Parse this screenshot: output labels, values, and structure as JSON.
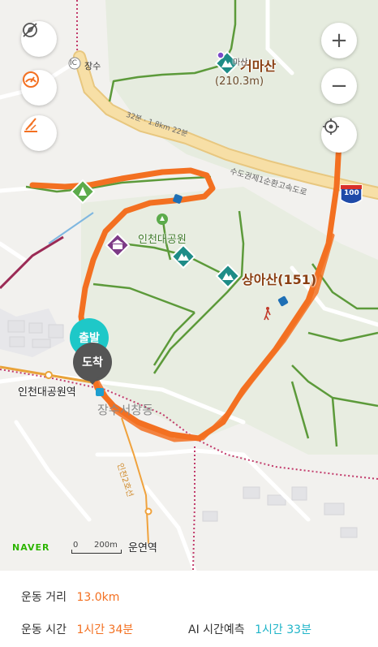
{
  "map": {
    "peaks": {
      "geoma": {
        "name": "거마산",
        "height": "(210.3m)",
        "sub": "마산"
      },
      "sanga": {
        "name": "상아산(151)"
      }
    },
    "park": {
      "name": "인천대공원"
    },
    "stations": {
      "incheon_park": "인천대공원역",
      "unyeon": "운연역",
      "ic": "IC",
      "jangsu": "장수"
    },
    "area": {
      "name": "장수서창동"
    },
    "roads": {
      "expressway": "수도권제1순환고속도로",
      "route_shield": "100",
      "trail_time": "32분 · 1.8km 22분",
      "rail_line": "인천2호선"
    },
    "markers": {
      "start": "출발",
      "end": "도착"
    },
    "logo": "NAVER",
    "scale": {
      "zero": "0",
      "distance": "200m"
    }
  },
  "controls": {
    "left": [
      "compass-off-icon",
      "speed-gauge-icon",
      "route-edit-icon"
    ],
    "zoom_in": "+",
    "zoom_out": "−",
    "locate": "locate-icon"
  },
  "stats": {
    "distance_label": "운동 거리",
    "distance_value": "13.0km",
    "time_label": "운동 시간",
    "time_value": "1시간 34분",
    "ai_label": "AI 시간예측",
    "ai_value": "1시간 33분"
  },
  "colors": {
    "route": "#f37021",
    "trail": "#5c9a3a",
    "accent_orange": "#f37021",
    "accent_teal": "#1eb4c8",
    "expressway": "#f7dfa6"
  }
}
